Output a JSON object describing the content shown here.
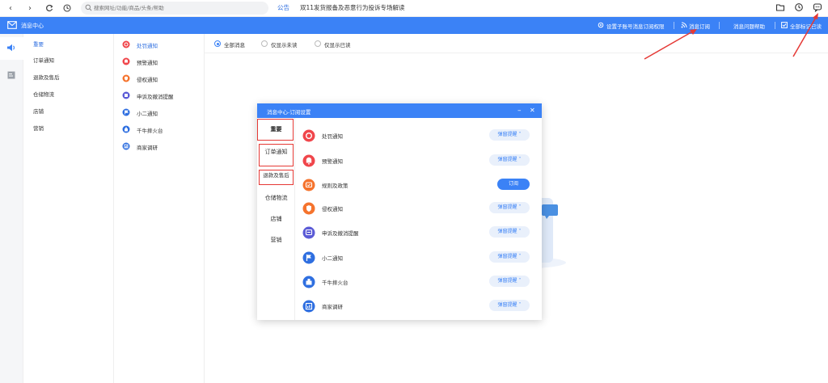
{
  "browser": {
    "search_placeholder": "搜索网址/功能/商品/头条/帮助",
    "notice_tag": "公告",
    "notice_text": "双11发货报备及恶意行为投诉专场解读"
  },
  "header": {
    "title": "消息中心",
    "links": [
      "设置子账号消息订阅权限",
      "消息订阅",
      "消息问题帮助",
      "全部标记已读"
    ]
  },
  "categories": [
    "重要",
    "订单通知",
    "退款及售后",
    "仓储物流",
    "店铺",
    "营销"
  ],
  "types": [
    {
      "label": "处罚通知",
      "icon": "penalty-icon",
      "color": "#f0464b"
    },
    {
      "label": "预警通知",
      "icon": "bell-icon",
      "color": "#f0464b"
    },
    {
      "label": "侵权通知",
      "icon": "shield-icon",
      "color": "#f5732d"
    },
    {
      "label": "申诉及撤消提醒",
      "icon": "appeal-icon",
      "color": "#5b5bd6"
    },
    {
      "label": "小二通知",
      "icon": "flag-icon",
      "color": "#2f6fe0"
    },
    {
      "label": "千牛摔火台",
      "icon": "tower-icon",
      "color": "#2f6fe0"
    },
    {
      "label": "商家调研",
      "icon": "survey-icon",
      "color": "#2f6fe0"
    }
  ],
  "filters": [
    "全部消息",
    "仅显示未读",
    "仅显示已读"
  ],
  "modal": {
    "title": "消息中心-订阅设置",
    "minimize": "–",
    "close": "✕",
    "categories": [
      "重要",
      "订单通知",
      "退款及售后",
      "仓储物流",
      "店铺",
      "营销"
    ],
    "rows": [
      {
        "label": "处罚通知",
        "button": "弹窗提醒 ˅",
        "primary": false,
        "icon": "penalty-icon",
        "color": "#f0464b"
      },
      {
        "label": "预警通知",
        "button": "弹窗提醒 ˅",
        "primary": false,
        "icon": "bell-icon",
        "color": "#f0464b"
      },
      {
        "label": "规则及政策",
        "button": "订阅",
        "primary": true,
        "icon": "rule-icon",
        "color": "#f5732d"
      },
      {
        "label": "侵权通知",
        "button": "弹窗提醒 ˅",
        "primary": false,
        "icon": "shield-icon",
        "color": "#f5732d"
      },
      {
        "label": "申诉及撤消提醒",
        "button": "弹窗提醒 ˅",
        "primary": false,
        "icon": "appeal-icon",
        "color": "#5b5bd6"
      },
      {
        "label": "小二通知",
        "button": "弹窗提醒 ˅",
        "primary": false,
        "icon": "flag-icon",
        "color": "#2f6fe0"
      },
      {
        "label": "千牛摔火台",
        "button": "弹窗提醒 ˅",
        "primary": false,
        "icon": "tower-icon",
        "color": "#2f6fe0"
      },
      {
        "label": "商家调研",
        "button": "弹窗提醒 ˅",
        "primary": false,
        "icon": "survey-icon",
        "color": "#2f6fe0"
      }
    ]
  },
  "colors": {
    "accent": "#3b82f6",
    "annotation": "#e53935"
  }
}
